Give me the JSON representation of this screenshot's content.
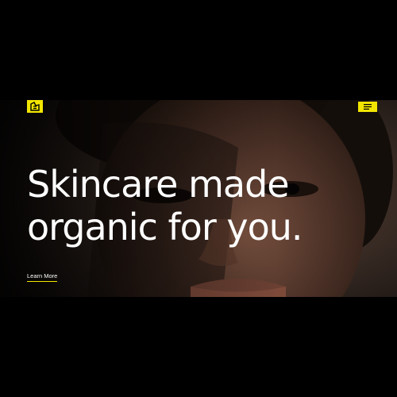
{
  "hero": {
    "headline_line1": "Skincare made",
    "headline_line2": "organic for you.",
    "cta_label": "Learn More"
  },
  "brand": {
    "accent_color": "#f2e600",
    "logo_icon": "five-logo-icon",
    "menu_icon": "hamburger-menu-icon"
  }
}
